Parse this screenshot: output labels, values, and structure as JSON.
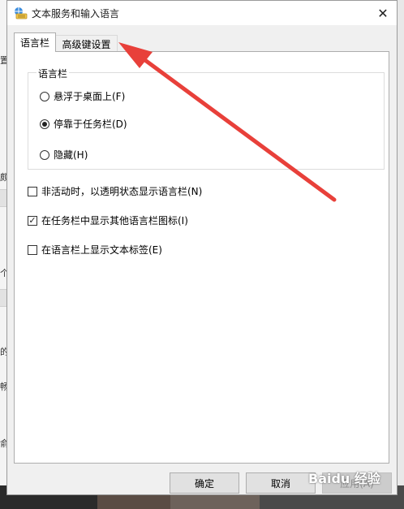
{
  "window": {
    "title": "文本服务和输入语言",
    "close_glyph": "✕"
  },
  "tabs": [
    {
      "label": "语言栏",
      "active": true
    },
    {
      "label": "高级键设置",
      "active": false
    }
  ],
  "language_bar_group": {
    "legend": "语言栏",
    "options": [
      {
        "label": "悬浮于桌面上(F)",
        "selected": false
      },
      {
        "label": "停靠于任务栏(D)",
        "selected": true
      },
      {
        "label": "隐藏(H)",
        "selected": false
      }
    ]
  },
  "checkboxes": [
    {
      "label": "非活动时，以透明状态显示语言栏(N)",
      "checked": false
    },
    {
      "label": "在任务栏中显示其他语言栏图标(I)",
      "checked": true
    },
    {
      "label": "在语言栏上显示文本标签(E)",
      "checked": false
    }
  ],
  "buttons": {
    "ok": "确定",
    "cancel": "取消",
    "apply": "应用(A)",
    "apply_enabled": false
  },
  "background": {
    "left_fragments": [
      "置",
      "颇",
      "个",
      "的",
      "畅",
      "俞"
    ]
  },
  "watermark": {
    "text": "Baidu 经验"
  },
  "annotation": {
    "arrow_color": "#e8403a",
    "points_to": "tab-advanced-key-settings"
  },
  "colors": {
    "window_bg": "#f0f0f0",
    "panel_bg": "#ffffff",
    "arrow": "#e8403a"
  }
}
